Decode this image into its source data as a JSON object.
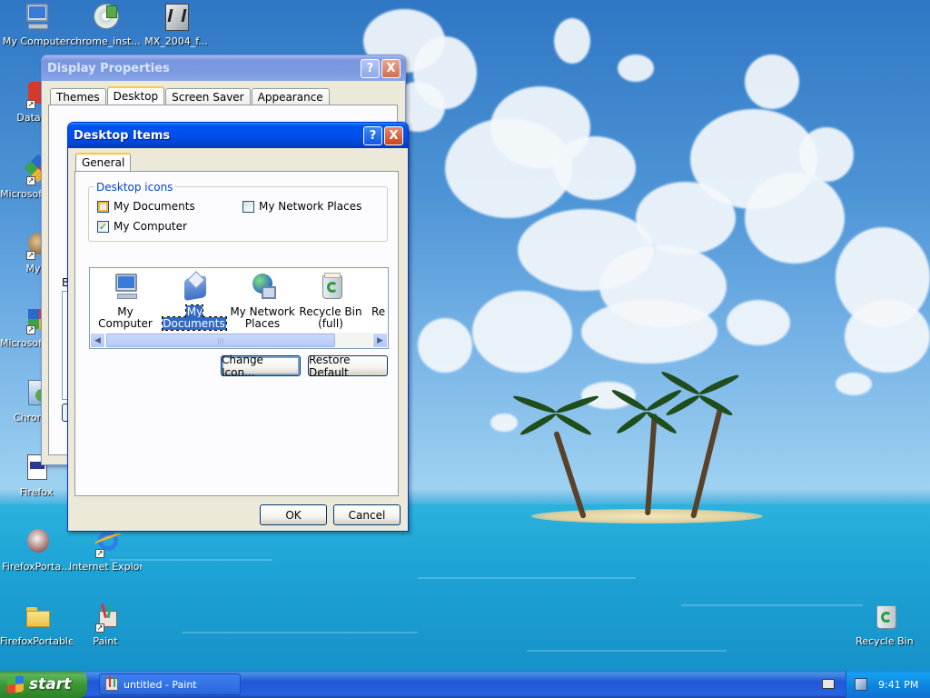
{
  "desktop": {
    "icons": [
      {
        "label": "My Computer",
        "icon": "my-computer-icon"
      },
      {
        "label": "chrome_inst...",
        "icon": "installer-cd-icon"
      },
      {
        "label": "MX_2004_f...",
        "icon": "macromedia-icon"
      },
      {
        "label": "DataWa",
        "icon": "shortcut-app-icon"
      },
      {
        "label": "Microsoft C++",
        "icon": "visual-cpp-icon"
      },
      {
        "label": "Myp",
        "icon": "app-shortcut-icon"
      },
      {
        "label": "Microsoft Basic",
        "icon": "visual-basic-icon"
      },
      {
        "label": "ChromeS",
        "icon": "chrome-setup-icon"
      },
      {
        "label": "Firefox",
        "icon": "firefox-doc-icon"
      },
      {
        "label": "FirefoxPorta...",
        "icon": "firefox-portable-icon"
      },
      {
        "label": "Internet Explorer",
        "icon": "internet-explorer-icon"
      },
      {
        "label": "FirefoxPortable",
        "icon": "folder-icon"
      },
      {
        "label": "Paint",
        "icon": "paint-icon"
      },
      {
        "label": "Recycle Bin",
        "icon": "recycle-bin-icon"
      }
    ]
  },
  "display_properties": {
    "title": "Display Properties",
    "tabs": [
      "Themes",
      "Desktop",
      "Screen Saver",
      "Appearance"
    ],
    "active_tab": "Desktop",
    "partial_label": "B"
  },
  "desktop_items": {
    "title": "Desktop Items",
    "tab": "General",
    "group_title": "Desktop icons",
    "checkboxes": [
      {
        "label": "My Documents",
        "checked": false
      },
      {
        "label": "My Network Places",
        "checked": false
      },
      {
        "label": "My Computer",
        "checked": true
      }
    ],
    "icon_list": [
      {
        "label": "My Computer",
        "icon": "my-computer-icon",
        "selected": false
      },
      {
        "label": "My Documents",
        "icon": "my-documents-icon",
        "selected": true
      },
      {
        "label": "My Network Places",
        "icon": "network-places-icon",
        "selected": false
      },
      {
        "label": "Recycle Bin (full)",
        "icon": "recycle-bin-full-icon",
        "selected": false
      },
      {
        "label": "Re",
        "icon": "recycle-bin-empty-icon",
        "selected": false
      }
    ],
    "buttons": {
      "change_icon": "Change Icon...",
      "restore_default": "Restore Default",
      "ok": "OK",
      "cancel": "Cancel"
    },
    "help_glyph": "?",
    "close_glyph": "X"
  },
  "taskbar": {
    "start_label": "start",
    "task_item": "untitled - Paint",
    "clock": "9:41 PM"
  },
  "colors": {
    "titlebar_active": "#0053ee",
    "titlebar_inactive": "#7a96df",
    "selection": "#316ac5",
    "group_title": "#0046d5",
    "start_green": "#3b9a36"
  }
}
